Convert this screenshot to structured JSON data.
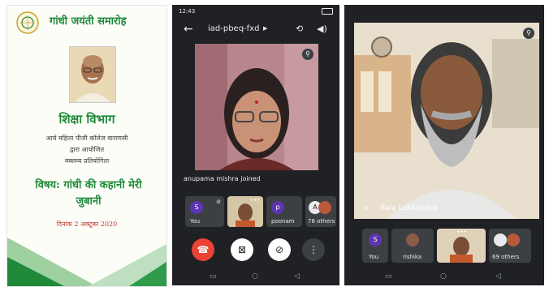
{
  "poster": {
    "title": "गांधी जयंती समारोह",
    "department": "शिक्षा विभाग",
    "college": "आर्य महिला पीजी कॉलेज वाराणसी",
    "organized": "द्वारा आयोजित",
    "competition": "वक्तव्य प्रतियोगिता",
    "subject_line1": "विषय: गांधी की कहानी मेरी",
    "subject_line2": "जुबानी",
    "date": "दिनांक 2 अक्टूबर 2020"
  },
  "phone": {
    "time": "12:43",
    "meeting_code": "iad-pbeq-fxd",
    "joined_message": "anupama mishra joined",
    "tiles": [
      {
        "avatar": "S",
        "label": "You"
      },
      {
        "avatar": "",
        "label": ""
      },
      {
        "avatar": "p",
        "label": "poonam"
      },
      {
        "avatar": "A",
        "label": "78 others"
      }
    ]
  },
  "tablet": {
    "speaker_name": "Bala Lakhendra",
    "tiles": [
      {
        "avatar": "S",
        "label": "You"
      },
      {
        "avatar": "",
        "label": "rishika"
      },
      {
        "avatar": "",
        "label": ""
      },
      {
        "avatar": "",
        "label": "69 others"
      }
    ]
  },
  "colors": {
    "poster_green": "#1f8a3a",
    "meet_dark": "#202124",
    "tile_gray": "#3c4043",
    "end_call_red": "#ea4335",
    "avatar_purple": "#5e35b1"
  },
  "icons": [
    "back-arrow-icon",
    "caret-right-icon",
    "camera-switch-icon",
    "speaker-icon",
    "pin-icon",
    "mic-off-icon",
    "end-call-icon",
    "camera-off-icon",
    "more-vert-icon"
  ]
}
